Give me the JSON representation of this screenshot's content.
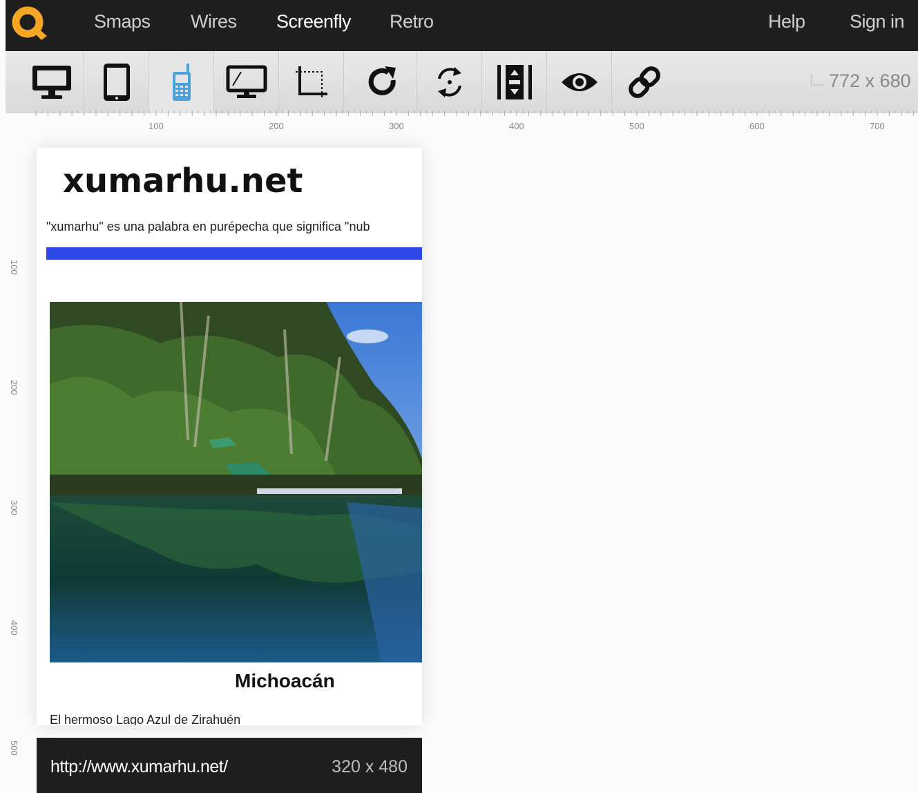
{
  "nav": {
    "logo_icon": "q-logo-icon",
    "links": [
      "Smaps",
      "Wires",
      "Screenfly",
      "Retro"
    ],
    "active": "Screenfly",
    "help": "Help",
    "signin": "Sign in"
  },
  "toolbar": {
    "tools": [
      "desktop-icon",
      "tablet-icon",
      "phone-icon",
      "tv-icon",
      "crop-icon",
      "refresh-icon",
      "rotate-icon",
      "scroll-icon",
      "eye-icon",
      "link-icon"
    ],
    "active_tool": "phone-icon",
    "viewport_dims": "772 x 680"
  },
  "rulers": {
    "horizontal": [
      "100",
      "200",
      "300",
      "400",
      "500",
      "600",
      "700"
    ],
    "vertical": [
      "100",
      "200",
      "300",
      "400",
      "500"
    ]
  },
  "site": {
    "title": "xumarhu.net",
    "tagline": "\"xumarhu\" es una palabra en purépecha que significa \"nub",
    "caption": "Michoacán",
    "body_text": "El hermoso Lago Azul de Zirahuén"
  },
  "device_bar": {
    "url": "http://www.xumarhu.net/",
    "dims": "320 x 480"
  },
  "colors": {
    "accent_orange": "#f5a623",
    "active_blue": "#4aa3df",
    "site_bar_blue": "#2c48e8"
  }
}
